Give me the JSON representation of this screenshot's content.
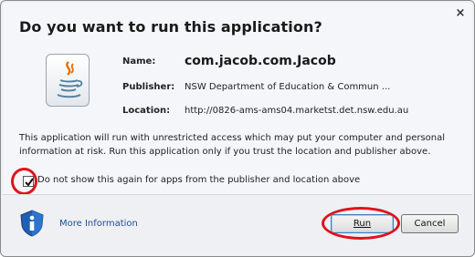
{
  "dialog": {
    "close_glyph": "×",
    "title": "Do you want to run this application?"
  },
  "fields": {
    "name_label": "Name:",
    "name_value": "com.jacob.com.Jacob",
    "publisher_label": "Publisher:",
    "publisher_value": "NSW Department of Education & Commun ...",
    "location_label": "Location:",
    "location_value": "http://0826-ams-ams04.marketst.det.nsw.edu.au"
  },
  "warning_text": "This application will run with unrestricted access which may put your computer and personal information at risk. Run this application only if you trust the location and publisher above.",
  "checkbox": {
    "checked": true,
    "label": "Do not show this again for apps from the publisher and location above"
  },
  "footer": {
    "more_info_label": "More Information",
    "run_label": "Run",
    "cancel_label": "Cancel"
  },
  "icons": {
    "app_icon": "java-icon",
    "info_icon": "info-shield-icon",
    "close_icon": "close-icon"
  },
  "colors": {
    "annotation_red": "#e0121b",
    "link_blue": "#1f4f8f"
  }
}
